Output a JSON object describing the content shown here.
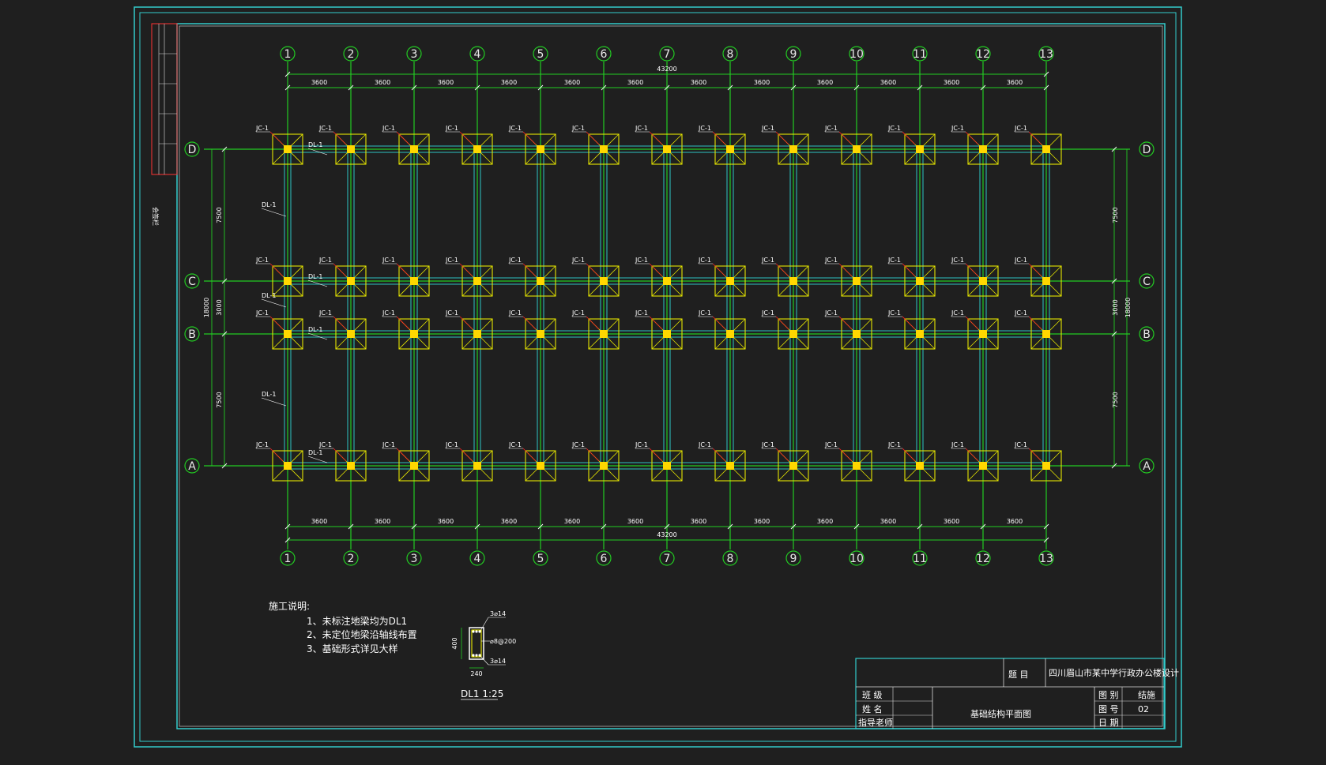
{
  "colors": {
    "background": "#1f1f1f",
    "frame": "#33cccc",
    "grid": "#22cc22",
    "beam": "#2aa0a0",
    "footing": "#e6e600",
    "column": "#ffd700",
    "leader": "#ff2222",
    "text": "#ffffff"
  },
  "grid": {
    "columns": [
      "1",
      "2",
      "3",
      "4",
      "5",
      "6",
      "7",
      "8",
      "9",
      "10",
      "11",
      "12",
      "13"
    ],
    "rows": [
      "D",
      "C",
      "B",
      "A"
    ]
  },
  "dimensions": {
    "bay": "3600",
    "total_width": "43200",
    "left_side": [
      "7500",
      "3000",
      "7500"
    ],
    "left_total": "18000",
    "right_side": [
      "7500",
      "3000",
      "7500"
    ],
    "right_total": "18000"
  },
  "tags": {
    "footing": "JC-1",
    "ground_beam": "DL-1"
  },
  "notes": {
    "title": "施工说明:",
    "items": [
      "1、未标注地梁均为DL1",
      "2、未定位地梁沿轴线布置",
      "3、基础形式详见大样"
    ]
  },
  "section": {
    "label": "DL1  1:25",
    "top_rebar": "3⌀14",
    "bottom_rebar": "3⌀14",
    "stirrup": "⌀8@200",
    "height": "400",
    "width": "240"
  },
  "title_block": {
    "subject_label": "题  目",
    "project_name": "四川眉山市某中学行政办公楼设计",
    "row_labels": [
      "班 级",
      "姓 名",
      "指导老师"
    ],
    "drawing_title": "基础结构平面图",
    "right_labels": [
      "图 别",
      "图 号",
      "日 期"
    ],
    "right_values": [
      "结施",
      "02",
      ""
    ]
  },
  "side_label": "会签栏"
}
